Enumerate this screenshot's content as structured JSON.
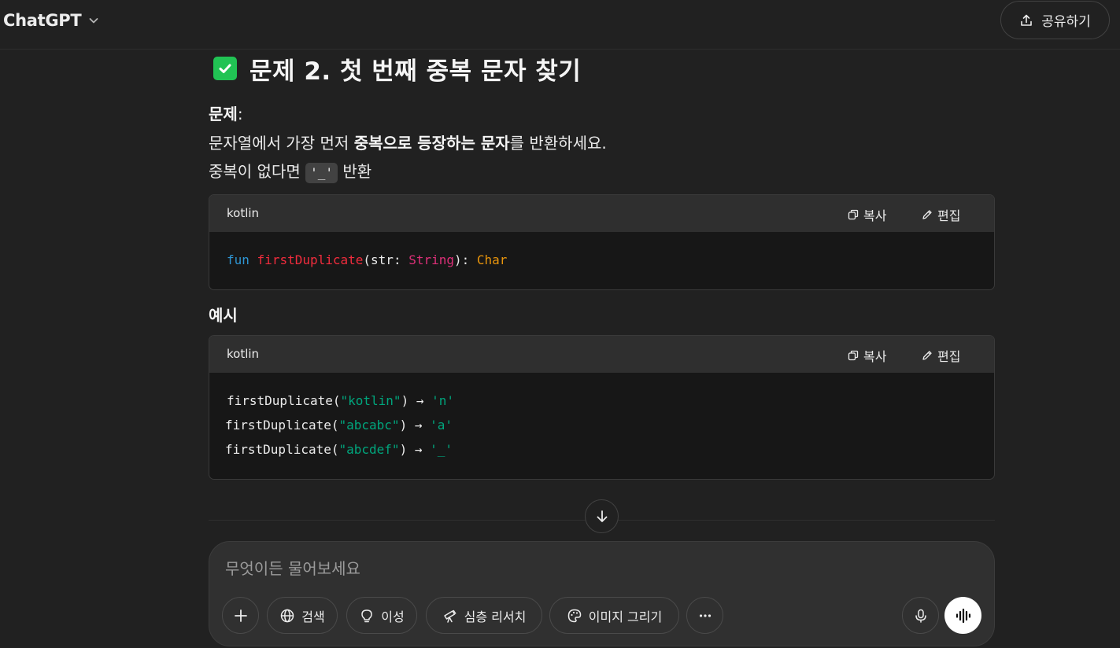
{
  "header": {
    "model_name": "ChatGPT",
    "share_label": "공유하기"
  },
  "message": {
    "heading": "문제 2. 첫 번째 중복 문자 찾기",
    "problem_label": "문제",
    "problem_colon": ":",
    "line1_a": "문자열에서 가장 먼저 ",
    "line1_bold": "중복으로 등장하는 문자",
    "line1_b": "를 반환하세요.",
    "line2_a": "중복이 없다면 ",
    "line2_code": "'_'",
    "line2_b": " 반환",
    "examples_title": "예시"
  },
  "code_blocks": [
    {
      "lang": "kotlin",
      "copy_label": "복사",
      "edit_label": "편집",
      "sig": {
        "kw": "fun",
        "fn": "firstDuplicate",
        "open": "(str: ",
        "type": "String",
        "close": "): ",
        "ret": "Char"
      }
    },
    {
      "lang": "kotlin",
      "copy_label": "복사",
      "edit_label": "편집",
      "lines": [
        {
          "call": "firstDuplicate(",
          "arg": "\"kotlin\"",
          "mid": ") → ",
          "res": "'n'"
        },
        {
          "call": "firstDuplicate(",
          "arg": "\"abcabc\"",
          "mid": ") → ",
          "res": "'a'"
        },
        {
          "call": "firstDuplicate(",
          "arg": "\"abcdef\"",
          "mid": ") → ",
          "res": "'_'"
        }
      ]
    }
  ],
  "composer": {
    "placeholder": "무엇이든 물어보세요",
    "tools": {
      "search": "검색",
      "reason": "이성",
      "deep_research": "심층 리서치",
      "image": "이미지 그리기"
    }
  },
  "colors": {
    "background": "#212121",
    "composer": "#303030",
    "check": "#21c354",
    "keyword": "#2e95d3",
    "function": "#f22c3d",
    "type": "#df3079",
    "return_type": "#e9950c",
    "string": "#00a67d"
  },
  "icons": [
    "chevron-down-icon",
    "share-icon",
    "check-box-icon",
    "copy-icon",
    "edit-icon",
    "arrow-down-icon",
    "plus-icon",
    "globe-icon",
    "bulb-icon",
    "telescope-icon",
    "palette-icon",
    "more-icon",
    "mic-icon",
    "voice-wave-icon"
  ]
}
